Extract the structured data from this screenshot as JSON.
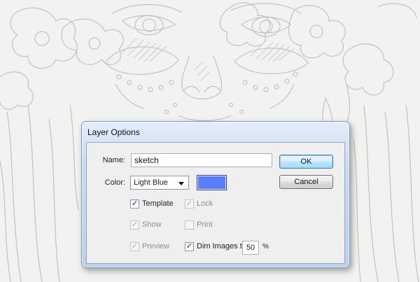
{
  "dialog": {
    "title": "Layer Options",
    "name_label": "Name:",
    "name_value": "sketch",
    "color_label": "Color:",
    "color_value": "Light Blue",
    "swatch_color": "#5a7eff",
    "ok_label": "OK",
    "cancel_label": "Cancel",
    "checkboxes": {
      "template": {
        "label": "Template",
        "checked": true,
        "enabled": true
      },
      "lock": {
        "label": "Lock",
        "checked": true,
        "enabled": false
      },
      "show": {
        "label": "Show",
        "checked": true,
        "enabled": false
      },
      "print": {
        "label": "Print",
        "checked": false,
        "enabled": false
      },
      "preview": {
        "label": "Preview",
        "checked": true,
        "enabled": false
      },
      "dim_images": {
        "label": "Dim Images to:",
        "checked": true,
        "enabled": true
      }
    },
    "dim_value": "50",
    "dim_unit": "%"
  },
  "icons": {
    "check_glyph": "✓"
  }
}
